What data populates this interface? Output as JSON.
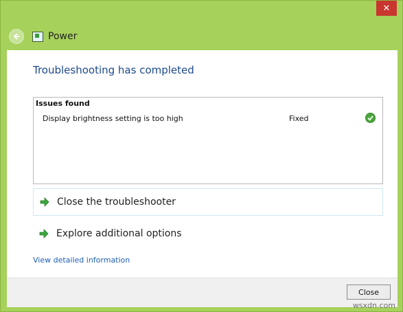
{
  "window": {
    "close_glyph": "✕",
    "colors": {
      "frame": "#a6d15a",
      "close": "#c8362f",
      "heading": "#1c4a8c",
      "link": "#1e5fb4"
    }
  },
  "titlebar": {
    "title": "Power",
    "back_icon": "back-arrow-icon",
    "app_icon": "power-troubleshooter-icon"
  },
  "main": {
    "heading": "Troubleshooting has completed",
    "issues": {
      "header": "Issues found",
      "rows": [
        {
          "description": "Display brightness setting is too high",
          "status": "Fixed",
          "status_icon": "check-icon"
        }
      ]
    },
    "commands": [
      {
        "label": "Close the troubleshooter",
        "icon": "green-arrow-icon"
      },
      {
        "label": "Explore additional options",
        "icon": "green-arrow-icon"
      }
    ],
    "detail_link": "View detailed information"
  },
  "footer": {
    "close_label": "Close"
  },
  "watermark": "wsxdn.com"
}
